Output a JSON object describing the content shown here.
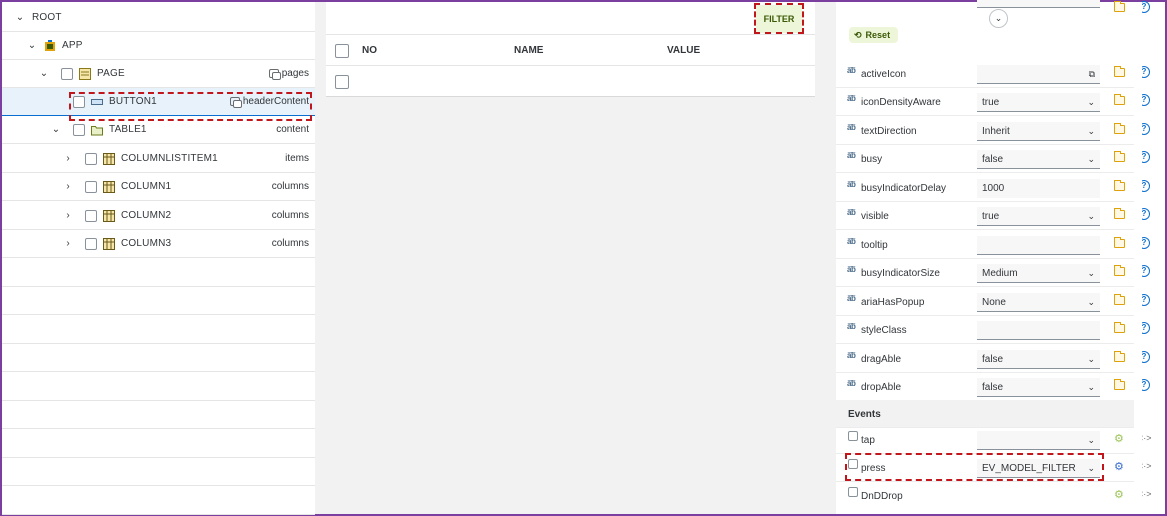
{
  "tree": {
    "rows": [
      {
        "label": "ROOT",
        "agg": ""
      },
      {
        "label": "APP",
        "agg": ""
      },
      {
        "label": "PAGE",
        "agg": "pages"
      },
      {
        "label": "BUTTON1",
        "agg": "headerContent"
      },
      {
        "label": "TABLE1",
        "agg": "content"
      },
      {
        "label": "COLUMNLISTITEM1",
        "agg": "items"
      },
      {
        "label": "COLUMN1",
        "agg": "columns"
      },
      {
        "label": "COLUMN2",
        "agg": "columns"
      },
      {
        "label": "COLUMN3",
        "agg": "columns"
      }
    ]
  },
  "middle": {
    "filter_label": "FILTER",
    "columns": [
      "NO",
      "NAME",
      "VALUE"
    ]
  },
  "properties": {
    "reset_label": "Reset",
    "rows": [
      {
        "name": "activeIcon",
        "value": "",
        "type": "input-copy"
      },
      {
        "name": "iconDensityAware",
        "value": "true",
        "type": "select"
      },
      {
        "name": "textDirection",
        "value": "Inherit",
        "type": "select"
      },
      {
        "name": "busy",
        "value": "false",
        "type": "select"
      },
      {
        "name": "busyIndicatorDelay",
        "value": "1000",
        "type": "input"
      },
      {
        "name": "visible",
        "value": "true",
        "type": "select"
      },
      {
        "name": "tooltip",
        "value": "",
        "type": "input"
      },
      {
        "name": "busyIndicatorSize",
        "value": "Medium",
        "type": "select"
      },
      {
        "name": "ariaHasPopup",
        "value": "None",
        "type": "select"
      },
      {
        "name": "styleClass",
        "value": "",
        "type": "input"
      },
      {
        "name": "dragAble",
        "value": "false",
        "type": "select"
      },
      {
        "name": "dropAble",
        "value": "false",
        "type": "select"
      }
    ],
    "events_title": "Events",
    "events": [
      {
        "name": "tap",
        "value": ""
      },
      {
        "name": "press",
        "value": "EV_MODEL_FILTER"
      },
      {
        "name": "DnDDrop",
        "value": ""
      }
    ]
  },
  "colors": {
    "accent": "#0a6ed1",
    "highlight_dash": "#c0161c",
    "frame": "#7b3fa0",
    "button_bg": "#eef6d9"
  }
}
